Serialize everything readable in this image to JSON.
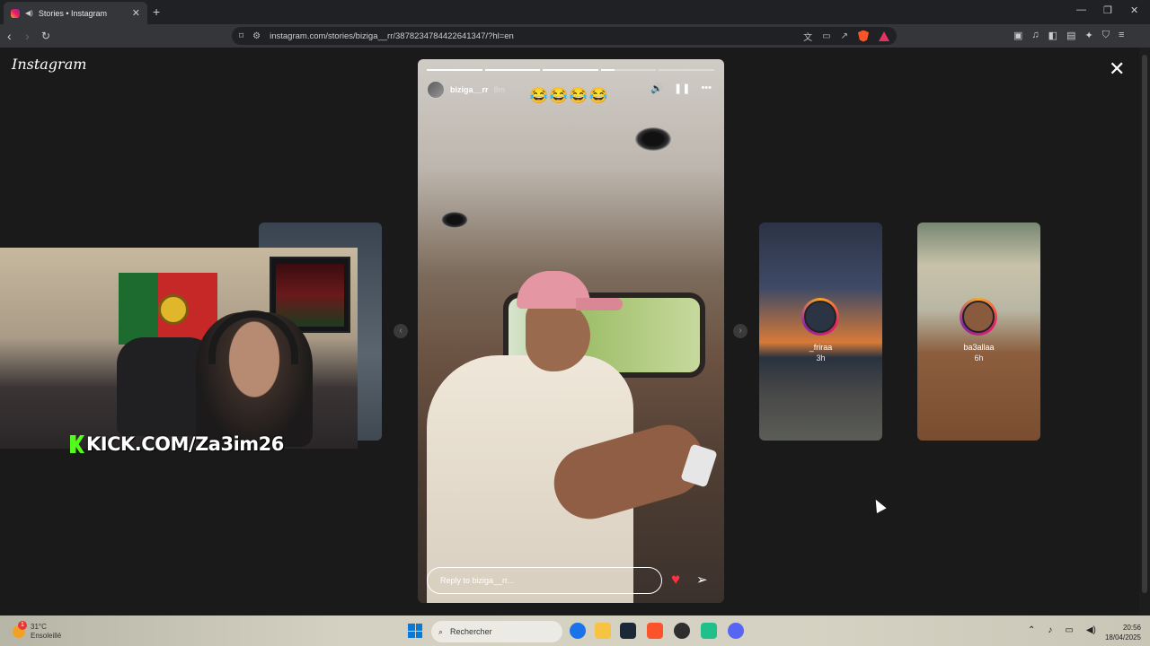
{
  "browser": {
    "tab_title": "Stories • Instagram",
    "new_tab": "+",
    "tab_close": "✕",
    "url": "instagram.com/stories/biziga__rr/3878234784422641347/?hl=en",
    "window_controls": [
      "—",
      "❐",
      "✕"
    ]
  },
  "page": {
    "logo": "Instagram",
    "close": "✕"
  },
  "story": {
    "username": "biziga__rr",
    "time": "8m",
    "emojis": "😂😂😂😂",
    "progress": [
      1.0,
      1.0,
      1.0,
      0.25,
      0.0
    ],
    "reply_placeholder": "Reply to biziga__rr...",
    "controls": {
      "mute": "🔊",
      "pause": "❚❚",
      "more": "•••"
    }
  },
  "side_stories": [
    {
      "username": "_friraa",
      "time": "3h"
    },
    {
      "username": "ba3allaa",
      "time": "6h"
    }
  ],
  "overlay": {
    "stream_text": "KICK.COM/Za3im26"
  },
  "taskbar": {
    "temperature": "31°C",
    "condition": "Ensoleillé",
    "notification_count": "1",
    "search_placeholder": "Rechercher",
    "time": "20:56",
    "date": "18/04/2025"
  },
  "colors": {
    "heart": "#ff3040",
    "kick_green": "#53fc18",
    "windows_blue": "#0a78d4",
    "brave_orange": "#fb542b"
  }
}
